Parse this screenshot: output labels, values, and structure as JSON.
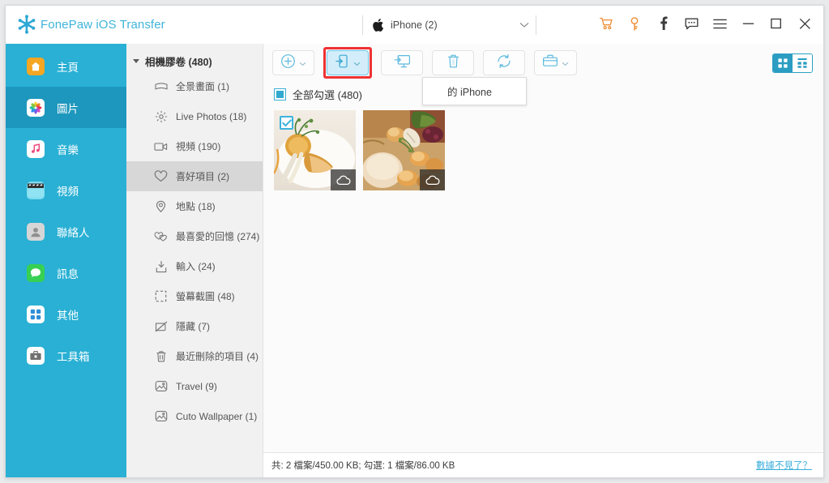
{
  "app": {
    "brand": "FonePaw iOS Transfer",
    "logo_icon": "snowflake-logo-icon"
  },
  "titlebar": {
    "device": {
      "icon": "apple-logo-icon",
      "label": "iPhone (2)",
      "caret_icon": "chevron-down-icon"
    },
    "tools": [
      {
        "name": "cart-icon",
        "glyph": "cart",
        "color": "#f08c33"
      },
      {
        "name": "key-icon",
        "glyph": "key",
        "color": "#f08c33"
      },
      {
        "name": "facebook-icon",
        "glyph": "f",
        "color": "#3c3c3c"
      },
      {
        "name": "feedback-icon",
        "glyph": "chat",
        "color": "#3c3c3c"
      },
      {
        "name": "menu-icon",
        "glyph": "hamburger",
        "color": "#3c3c3c"
      },
      {
        "name": "minimize-icon",
        "glyph": "minimize",
        "color": "#3c3c3c"
      },
      {
        "name": "maximize-icon",
        "glyph": "maximize",
        "color": "#3c3c3c"
      },
      {
        "name": "close-icon",
        "glyph": "close",
        "color": "#3c3c3c"
      }
    ]
  },
  "sidebar": {
    "items": [
      {
        "label": "主頁",
        "icon": "home-icon",
        "active": false
      },
      {
        "label": "圖片",
        "icon": "photos-icon",
        "active": true
      },
      {
        "label": "音樂",
        "icon": "music-icon",
        "active": false
      },
      {
        "label": "視頻",
        "icon": "video-icon",
        "active": false
      },
      {
        "label": "聯絡人",
        "icon": "contacts-icon",
        "active": false
      },
      {
        "label": "訊息",
        "icon": "messages-icon",
        "active": false
      },
      {
        "label": "其他",
        "icon": "other-icon",
        "active": false
      },
      {
        "label": "工具箱",
        "icon": "toolbox-icon",
        "active": false
      }
    ]
  },
  "tree": {
    "header": {
      "label": "相機膠卷 (480)",
      "expanded": true
    },
    "items": [
      {
        "label": "全景畫面 (1)",
        "icon": "panorama-icon",
        "selected": false
      },
      {
        "label": "Live Photos (18)",
        "icon": "live-photo-icon",
        "selected": false
      },
      {
        "label": "視頻 (190)",
        "icon": "video-camera-icon",
        "selected": false
      },
      {
        "label": "喜好項目 (2)",
        "icon": "heart-icon",
        "selected": true
      },
      {
        "label": "地點 (18)",
        "icon": "location-pin-icon",
        "selected": false
      },
      {
        "label": "最喜愛的回憶 (274)",
        "icon": "double-heart-icon",
        "selected": false
      },
      {
        "label": "輸入 (24)",
        "icon": "import-icon",
        "selected": false
      },
      {
        "label": "螢幕截圖 (48)",
        "icon": "screenshot-icon",
        "selected": false
      },
      {
        "label": "隱藏 (7)",
        "icon": "hidden-eye-icon",
        "selected": false
      },
      {
        "label": "最近刪除的項目 (4)",
        "icon": "trash-icon",
        "selected": false
      },
      {
        "label": "Travel (9)",
        "icon": "album-icon",
        "selected": false
      },
      {
        "label": "Cuto Wallpaper (1)",
        "icon": "album-icon",
        "selected": false
      }
    ]
  },
  "toolbar": {
    "buttons": [
      {
        "name": "add-button",
        "icon": "plus-circle-icon",
        "caret": true,
        "highlighted": false
      },
      {
        "name": "export-to-device-button",
        "icon": "phone-export-icon",
        "caret": true,
        "highlighted": true
      },
      {
        "name": "export-to-pc-button",
        "icon": "monitor-export-icon",
        "caret": false,
        "highlighted": false
      },
      {
        "name": "delete-button",
        "icon": "trash-icon",
        "caret": false,
        "highlighted": false
      },
      {
        "name": "refresh-button",
        "icon": "refresh-icon",
        "caret": false,
        "highlighted": false
      },
      {
        "name": "toolbox-button",
        "icon": "toolkit-icon",
        "caret": true,
        "highlighted": false
      }
    ],
    "view_toggle": [
      {
        "name": "grid-view-button",
        "icon": "grid-icon",
        "active": true
      },
      {
        "name": "list-view-button",
        "icon": "list-grid-icon",
        "active": false
      }
    ]
  },
  "popup": {
    "label": "的 iPhone"
  },
  "select_all": {
    "label": "全部勾選 (480)",
    "checked": true
  },
  "thumbnails": [
    {
      "name": "photo-thumbnail-1",
      "selected": true,
      "cloud": true,
      "alt": "plated dessert with garnish"
    },
    {
      "name": "photo-thumbnail-2",
      "selected": false,
      "cloud": true,
      "alt": "gourmet dish with vegetables"
    }
  ],
  "statusbar": {
    "text": "共: 2 檔案/450.00 KB; 勾選: 1 檔案/86.00 KB",
    "link": "數據不見了？"
  },
  "colors": {
    "sidebar": "#29b0d4",
    "sidebar_active": "#1d97bd",
    "brand": "#3fb4d9",
    "accent": "#2b9dc2",
    "highlight_box": "#ef3233",
    "highlight_fill": "#d3eefa",
    "link": "#3aaedb",
    "orange": "#f08c33"
  }
}
